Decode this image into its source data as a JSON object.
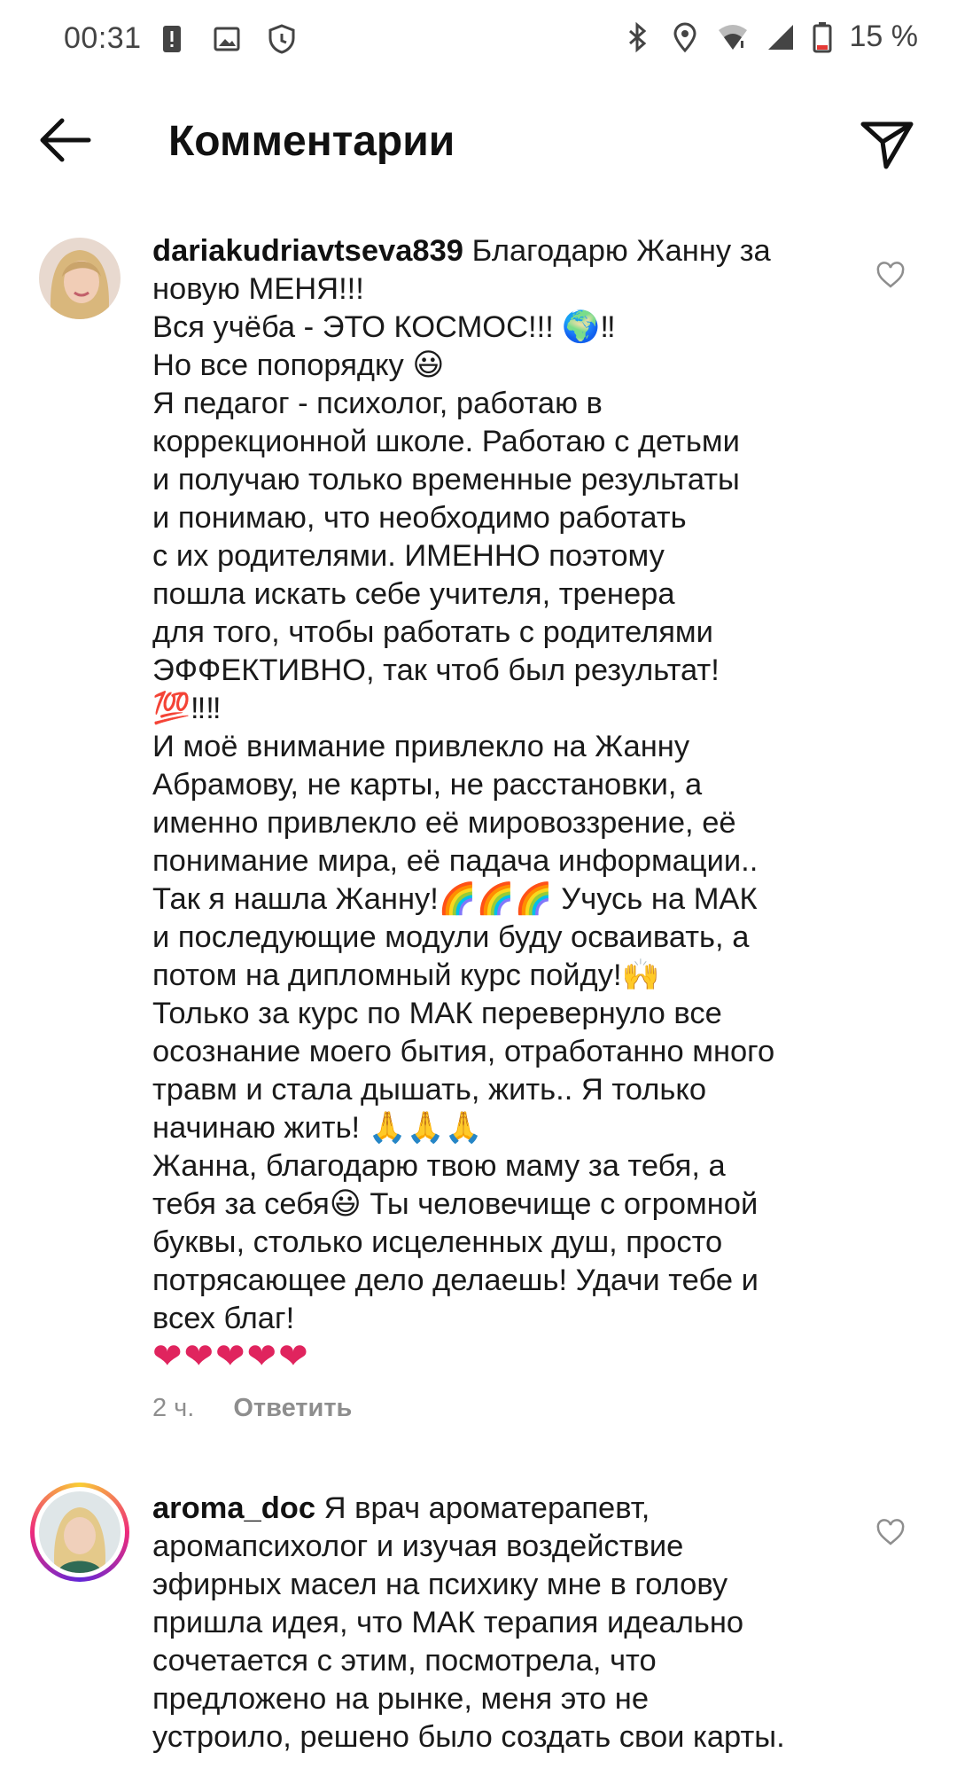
{
  "status_bar": {
    "time": "00:31",
    "battery": "15 %",
    "icons": [
      "alert-icon",
      "image-icon",
      "shield-icon",
      "bluetooth-icon",
      "location-icon",
      "wifi-icon",
      "signal-icon",
      "battery-icon"
    ]
  },
  "header": {
    "title": "Комментарии",
    "back_icon": "arrow-left-icon",
    "send_icon": "paper-plane-icon"
  },
  "colors": {
    "like_heart": "#e0245e",
    "muted": "#8e8e8e"
  },
  "comments": [
    {
      "username": "dariakudriavtseva839",
      "first_line": "Благодарю Жанну за",
      "lines": [
        "новую МЕНЯ!!!",
        "Вся учёба - ЭТО КОСМОС!!! 🌍‼",
        "Но все попорядку 😃",
        "Я педагог - психолог, работаю в",
        "коррекционной школе. Работаю с детьми",
        "и получаю только временные результаты",
        "и понимаю, что необходимо работать",
        "с их родителями. ИМЕННО поэтому",
        "пошла искать себе учителя, тренера",
        "для того, чтобы работать с родителями",
        "ЭФФЕКТИВНО, так чтоб был результат!",
        "💯‼‼",
        "И моё внимание привлекло на Жанну",
        "Абрамову, не карты, не расстановки, а",
        "именно привлекло её мировоззрение, её",
        "понимание мира, её падача информации..",
        "Так я нашла Жанну!🌈🌈🌈 Учусь на МАК",
        "и последующие модули буду осваивать, а",
        "потом на дипломный курс пойду!🙌",
        "Только за курс по МАК перевернуло все",
        "осознание моего бытия, отработанно много",
        "травм и стала дышать, жить.. Я только",
        "начинаю жить! 🙏🙏🙏",
        "Жанна, благодарю твою маму за тебя, а",
        "тебя за себя😃 Ты человечище с огромной",
        "буквы, столько исцеленных душ, просто",
        "потрясающее дело делаешь! Удачи тебе и",
        "всех благ!"
      ],
      "hearts": "❤❤❤❤❤",
      "time": "2 ч.",
      "reply_label": "Ответить"
    },
    {
      "username": "aroma_doc",
      "first_line": "Я врач ароматерапевт,",
      "lines": [
        "аромапсихолог и изучая воздействие",
        "эфирных масел на психику мне в голову",
        "пришла идея, что МАК терапия идеально",
        "сочетается с этим, посмотрела, что",
        "предложено на рынке, меня это не",
        "устроило, решено было создать свои карты."
      ]
    }
  ]
}
